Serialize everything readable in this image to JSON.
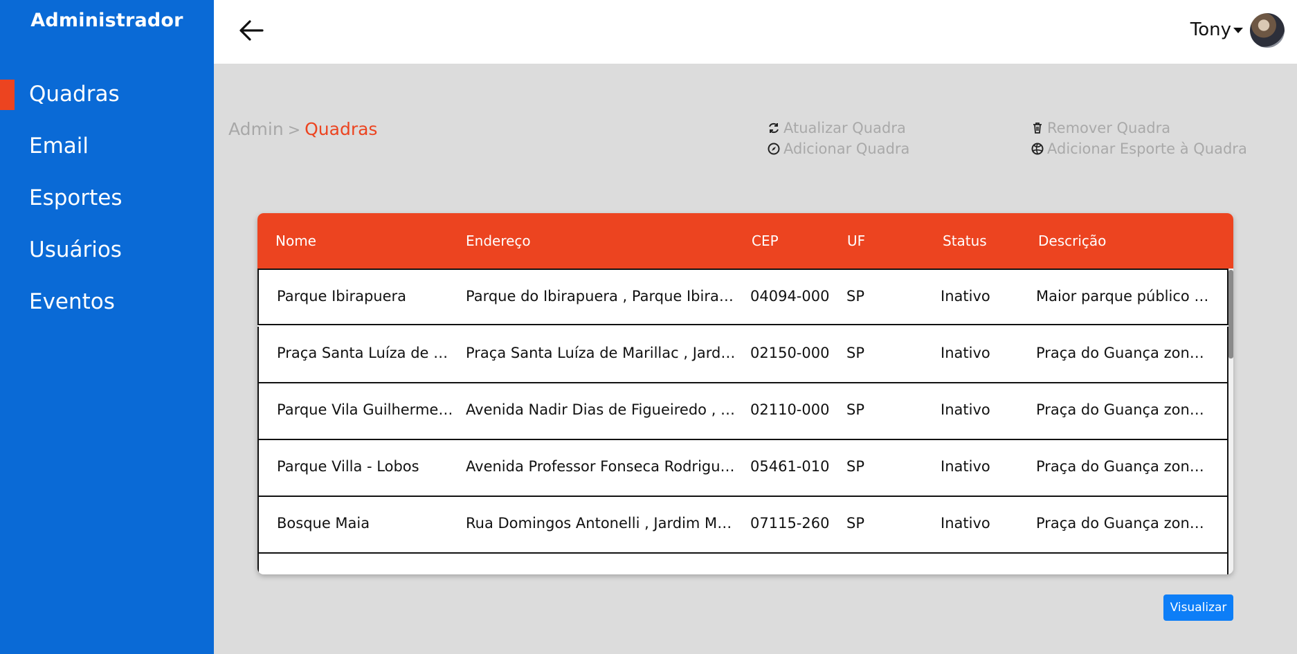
{
  "sidebar": {
    "title": "Administrador",
    "items": [
      {
        "label": "Quadras",
        "active": true
      },
      {
        "label": "Email"
      },
      {
        "label": "Esportes"
      },
      {
        "label": "Usuários"
      },
      {
        "label": "Eventos"
      }
    ]
  },
  "topbar": {
    "user": "Tony"
  },
  "breadcrumb": {
    "root": "Admin",
    "separator": ">",
    "current": "Quadras"
  },
  "actions": {
    "update": "Atualizar Quadra",
    "add": "Adicionar Quadra",
    "remove": "Remover Quadra",
    "add_sport": "Adicionar Esporte à Quadra"
  },
  "table": {
    "columns": [
      "Nome",
      "Endereço",
      "CEP",
      "UF",
      "Status",
      "Descrição"
    ],
    "rows": [
      [
        "Parque Ibirapuera",
        "Parque do Ibirapuera , Parque Ibirapu…",
        "04094-000",
        "SP",
        "Inativo",
        "Maior parque público d…"
      ],
      [
        "Praça Santa Luíza de M…",
        "Praça Santa Luíza de Marillac , Jardi…",
        "02150-000",
        "SP",
        "Inativo",
        "Praça do Guança zona …"
      ],
      [
        "Parque Vila Guilherme -…",
        "Avenida Nadir Dias de Figueiredo , Vil…",
        "02110-000",
        "SP",
        "Inativo",
        "Praça do Guança zona …"
      ],
      [
        "Parque Villa - Lobos",
        "Avenida Professor Fonseca Rodrigues…",
        "05461-010",
        "SP",
        "Inativo",
        "Praça do Guança zona …"
      ],
      [
        "Bosque Maia",
        "Rua Domingos Antonelli , Jardim Mari…",
        "07115-260",
        "SP",
        "Inativo",
        "Praça do Guança zona …"
      ]
    ]
  },
  "buttons": {
    "view": "Visualizar"
  },
  "colors": {
    "sidebar": "#0a6ad6",
    "accent": "#ec4420",
    "primary_button": "#0d7ef7"
  }
}
